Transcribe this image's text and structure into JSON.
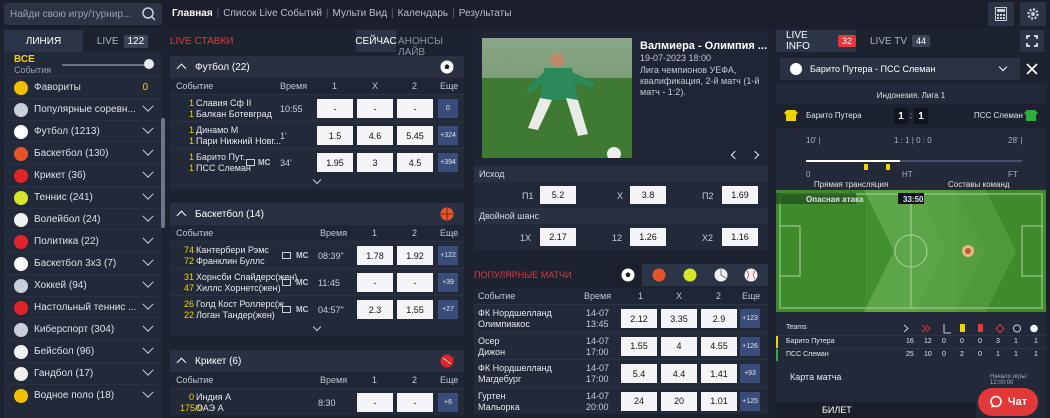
{
  "search": {
    "placeholder": "Найди свою игру/турнир..."
  },
  "nav": {
    "items": [
      "Главная",
      "Список Live Событий",
      "Мульти Вид",
      "Календарь",
      "Результаты"
    ]
  },
  "sidebar": {
    "tab_line": "ЛИНИЯ",
    "tab_live": "LIVE",
    "live_count": "122",
    "all_title": "ВСЕ",
    "all_sub": "События",
    "items": [
      {
        "label": "Фавориты",
        "icon": "star-icon",
        "color": "#f0c000",
        "zero": "0"
      },
      {
        "label": "Популярные соревн...",
        "icon": "pin-icon",
        "color": "#c9ced8"
      },
      {
        "label": "Футбол (1213)",
        "icon": "football-icon",
        "color": "#ffffff"
      },
      {
        "label": "Баскетбол (130)",
        "icon": "basketball-icon",
        "color": "#e8542a"
      },
      {
        "label": "Крикет (36)",
        "icon": "cricket-icon",
        "color": "#e0242a"
      },
      {
        "label": "Теннис (241)",
        "icon": "tennis-icon",
        "color": "#d6e52a"
      },
      {
        "label": "Волейбол (24)",
        "icon": "volleyball-icon",
        "color": "#f1f1f1"
      },
      {
        "label": "Политика (22)",
        "icon": "politics-icon",
        "color": "#e0242a"
      },
      {
        "label": "Баскетбол 3x3 (7)",
        "icon": "basketball3x3-icon",
        "color": "#ffffff"
      },
      {
        "label": "Хоккей (94)",
        "icon": "hockey-icon",
        "color": "#c9ced8"
      },
      {
        "label": "Настольный теннис ...",
        "icon": "table-tennis-icon",
        "color": "#e0242a"
      },
      {
        "label": "Киберспорт (304)",
        "icon": "esports-icon",
        "color": "#c9ced8"
      },
      {
        "label": "Бейсбол (96)",
        "icon": "baseball-icon",
        "color": "#f1f1f1"
      },
      {
        "label": "Гандбол (17)",
        "icon": "handball-icon",
        "color": "#f1f1f1"
      },
      {
        "label": "Водное поло (18)",
        "icon": "waterpolo-icon",
        "color": "#f0c000"
      }
    ]
  },
  "live": {
    "title": "LIVE СТАВКИ",
    "tab_now": "СЕЙЧАС",
    "tab_ann": "АНОНСЫ ЛАЙВ",
    "columns": {
      "event": "Событие",
      "time": "Время",
      "c1": "1",
      "cx": "X",
      "c2": "2",
      "more": "Еще"
    },
    "football": {
      "title": "Футбол",
      "count": "(22)",
      "rows": [
        {
          "s1": "1",
          "s2": "1",
          "t1": "Славия Сф II",
          "t2": "Балкан Ботевград",
          "time": "10:55",
          "o1": "-",
          "ox": "-",
          "o2": "-",
          "more": "0"
        },
        {
          "s1": "1",
          "s2": "1",
          "t1": "Динамо М",
          "t2": "Пари Нижний Новг...",
          "time": "1'",
          "o1": "1.5",
          "ox": "4.6",
          "o2": "5.45",
          "more": "+324"
        },
        {
          "s1": "1",
          "s2": "1",
          "t1": "Барито Пут...",
          "t2": "ПСС Слеман",
          "mc": "MC",
          "time": "34'",
          "o1": "1.95",
          "ox": "3",
          "o2": "4.5",
          "more": "+394"
        }
      ]
    },
    "basketball": {
      "title": "Баскетбол",
      "count": "(14)",
      "rows": [
        {
          "s1": "74",
          "s2": "72",
          "t1": "Кантербери Рэмс",
          "t2": "Франклин Буллс",
          "mc": "MC",
          "time": "08:39\"",
          "o1": "1.78",
          "o2": "1.92",
          "more": "+122"
        },
        {
          "s1": "31",
          "s2": "47",
          "t1": "Хорнсби Спайдерс(жен)",
          "t2": "Хиллс Хорнетс(жен)",
          "mc": "MC",
          "time": "11:45",
          "o1": "-",
          "o2": "-",
          "more": "+39"
        },
        {
          "s1": "26",
          "s2": "22",
          "t1": "Голд Кост Роллерс(ж...",
          "t2": "Логан Тандер(жен)",
          "mc": "MC",
          "time": "04:57\"",
          "o1": "2.3",
          "o2": "1.55",
          "more": "+27"
        }
      ]
    },
    "cricket": {
      "title": "Крикет",
      "count": "(6)",
      "rows": [
        {
          "s1": "0",
          "s2": "175/9",
          "t1": "Индия А",
          "t2": "ОАЭ А",
          "time": "8:30",
          "o1": "-",
          "o2": "-",
          "more": "+6"
        }
      ]
    }
  },
  "featured": {
    "title": "Валмиера - Олимпия ...",
    "date": "19-07-2023 18:00",
    "desc": "Лига чемпионов УЕФА, квалификация, 2-й матч (1-й матч - 1:2).",
    "outcome": "Исход",
    "double": "Двойной шанс",
    "o": {
      "p1_l": "П1",
      "p1": "5.2",
      "x_l": "X",
      "x": "3.8",
      "p2_l": "П2",
      "p2": "1.69",
      "x1_l": "1X",
      "x1": "2.17",
      "d12_l": "12",
      "d12": "1.26",
      "x2_l": "X2",
      "x2": "1.16"
    }
  },
  "popular": {
    "title": "ПОПУЛЯРНЫЕ МАТЧИ",
    "columns": {
      "event": "Событие",
      "time": "Время",
      "c1": "1",
      "cx": "X",
      "c2": "2",
      "more": "Еще"
    },
    "rows": [
      {
        "t1": "ФК Нордшелланд",
        "t2": "Олимпиакос",
        "d": "14-07",
        "h": "13:45",
        "o1": "2.12",
        "ox": "3.35",
        "o2": "2.9",
        "more": "+123"
      },
      {
        "t1": "Осер",
        "t2": "Дижон",
        "d": "14-07",
        "h": "17:00",
        "o1": "1.55",
        "ox": "4",
        "o2": "4.55",
        "more": "+126"
      },
      {
        "t1": "ФК Нордшелланд",
        "t2": "Магдебург",
        "d": "14-07",
        "h": "17:00",
        "o1": "5.4",
        "ox": "4.4",
        "o2": "1.41",
        "more": "+93"
      },
      {
        "t1": "Гуртен",
        "t2": "Мальорка",
        "d": "14-07",
        "h": "20:00",
        "o1": "24",
        "ox": "20",
        "o2": "1.01",
        "more": "+125"
      }
    ]
  },
  "right": {
    "live_info": "LIVE INFO",
    "live_info_count": "32",
    "live_tv": "LIVE TV",
    "live_tv_count": "44",
    "match": "Барито Путера - ПСС Слеман",
    "league": "Индонезия. Лига 1",
    "home": "Барито Путера",
    "away": "ПСС Слеман",
    "hs": "1",
    "as": "1",
    "half1": "1 : 1 | 0 : 0",
    "m1": "10' |",
    "m2": "28' |",
    "t0": "0",
    "tht": "HT",
    "tft": "FT",
    "broadcast": "Прямая трансляция",
    "lineups": "Составы команд",
    "danger": "Опасная атака",
    "clock": "33:50",
    "teams": "Teams",
    "stats": [
      {
        "team": "Барито Путера",
        "v": [
          "16",
          "12",
          "0",
          "0",
          "0",
          "3",
          "1",
          "1"
        ]
      },
      {
        "team": "ПСС Слеман",
        "v": [
          "25",
          "10",
          "0",
          "2",
          "0",
          "1",
          "1",
          "1"
        ]
      }
    ],
    "map": "Карта матча",
    "start": "Начало игры: 12:00:00",
    "bilet": "БИЛЕТ",
    "chat": "Чат"
  }
}
